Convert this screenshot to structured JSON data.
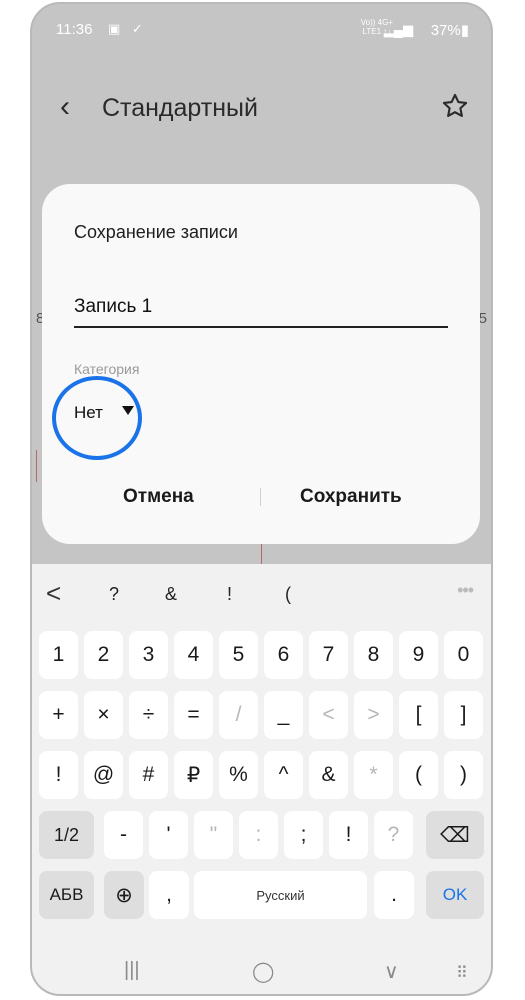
{
  "status_bar": {
    "time": "11:36",
    "notification_icons": "▣ ✓",
    "network_top": "Vo)) 4G+",
    "network_bottom": "LTE1 ↑↓",
    "signal": "▂▄▆",
    "battery": "37%▮"
  },
  "app_bar": {
    "back_icon": "‹",
    "title": "Стандартный"
  },
  "background": {
    "left_fragment": "8",
    "right_fragment": "5"
  },
  "dialog": {
    "title": "Сохранение записи",
    "entry_value": "Запись 1",
    "category_label": "Категория",
    "category_value": "Нет",
    "cancel_label": "Отмена",
    "save_label": "Сохранить",
    "highlight_color": "#1a73e8"
  },
  "keyboard": {
    "suggestions": {
      "back_icon": "<",
      "items": [
        "?",
        "&",
        "!",
        "("
      ],
      "more_icon": "•••"
    },
    "row1": [
      "1",
      "2",
      "3",
      "4",
      "5",
      "6",
      "7",
      "8",
      "9",
      "0"
    ],
    "row2": [
      "+",
      "×",
      "÷",
      "=",
      "/",
      "_",
      "<",
      ">",
      "[",
      "]"
    ],
    "row3": [
      "!",
      "@",
      "#",
      "₽",
      "%",
      "^",
      "&",
      "*",
      "(",
      ")"
    ],
    "row4": [
      "1/2",
      "-",
      "'",
      "\"",
      ":",
      ";",
      "!",
      "?",
      "⌫"
    ],
    "row5": {
      "lang_switch": "АБВ",
      "globe_icon": "⊕",
      "comma": ",",
      "space": "Русский",
      "period": ".",
      "ok": "OK"
    },
    "accent_color": "#1a73e8"
  },
  "nav_bar": {
    "recents_icon": "|||",
    "home_icon": "◯",
    "back_icon": "∨",
    "keyboard_icon": "⠿"
  }
}
